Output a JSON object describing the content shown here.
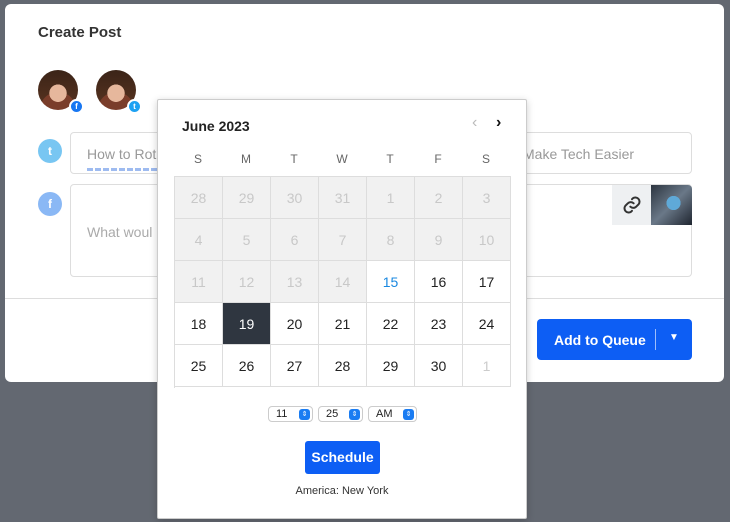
{
  "modal": {
    "title": "Create Post"
  },
  "accounts": [
    {
      "network": "facebook",
      "badge_icon": "f"
    },
    {
      "network": "twitter",
      "badge_icon": "t"
    }
  ],
  "editors": {
    "twitter": {
      "text_start": "How to Rot",
      "text_end": "Make Tech Easier"
    },
    "facebook": {
      "placeholder": "What woul"
    }
  },
  "actions": {
    "add_to_queue": "Add to Queue",
    "dropdown_icon": "▼"
  },
  "calendar": {
    "month_label": "June 2023",
    "prev_icon": "‹",
    "next_icon": "›",
    "weekdays": [
      "S",
      "M",
      "T",
      "W",
      "T",
      "F",
      "S"
    ],
    "weeks": [
      [
        {
          "d": "28",
          "s": "past"
        },
        {
          "d": "29",
          "s": "past"
        },
        {
          "d": "30",
          "s": "past"
        },
        {
          "d": "31",
          "s": "past"
        },
        {
          "d": "1",
          "s": "past"
        },
        {
          "d": "2",
          "s": "past"
        },
        {
          "d": "3",
          "s": "past"
        }
      ],
      [
        {
          "d": "4",
          "s": "past"
        },
        {
          "d": "5",
          "s": "past"
        },
        {
          "d": "6",
          "s": "past"
        },
        {
          "d": "7",
          "s": "past"
        },
        {
          "d": "8",
          "s": "past"
        },
        {
          "d": "9",
          "s": "past"
        },
        {
          "d": "10",
          "s": "past"
        }
      ],
      [
        {
          "d": "11",
          "s": "past"
        },
        {
          "d": "12",
          "s": "past"
        },
        {
          "d": "13",
          "s": "past"
        },
        {
          "d": "14",
          "s": "past"
        },
        {
          "d": "15",
          "s": "today"
        },
        {
          "d": "16",
          "s": ""
        },
        {
          "d": "17",
          "s": ""
        }
      ],
      [
        {
          "d": "18",
          "s": ""
        },
        {
          "d": "19",
          "s": "selected"
        },
        {
          "d": "20",
          "s": ""
        },
        {
          "d": "21",
          "s": ""
        },
        {
          "d": "22",
          "s": ""
        },
        {
          "d": "23",
          "s": ""
        },
        {
          "d": "24",
          "s": ""
        }
      ],
      [
        {
          "d": "25",
          "s": ""
        },
        {
          "d": "26",
          "s": ""
        },
        {
          "d": "27",
          "s": ""
        },
        {
          "d": "28",
          "s": ""
        },
        {
          "d": "29",
          "s": ""
        },
        {
          "d": "30",
          "s": ""
        },
        {
          "d": "1",
          "s": "other"
        }
      ]
    ],
    "time": {
      "hour": "11",
      "minute": "25",
      "ampm": "AM"
    },
    "schedule_label": "Schedule",
    "timezone": "America: New York"
  },
  "colors": {
    "accent": "#0d5ef4",
    "selected_day": "#2f3640",
    "today": "#1a88e0"
  }
}
